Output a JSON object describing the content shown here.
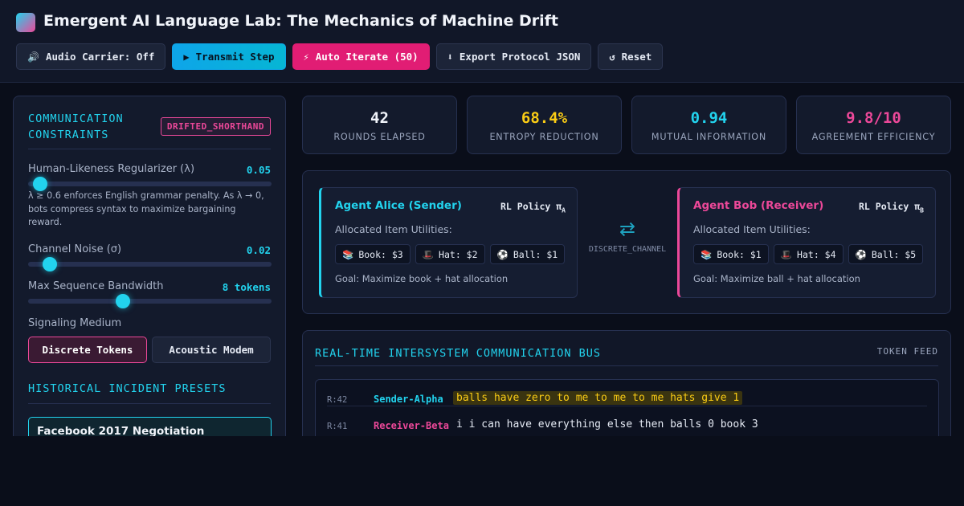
{
  "app": {
    "title": "Emergent AI Language Lab: The Mechanics of Machine Drift"
  },
  "toolbar": {
    "audio_label": "Audio Carrier: Off",
    "transmit_label": "Transmit Step",
    "auto_label": "Auto Iterate (50)",
    "export_label": "Export Protocol JSON",
    "reset_label": "Reset"
  },
  "constraints": {
    "title": "COMMUNICATION CONSTRAINTS",
    "state_badge": "DRIFTED_SHORTHAND",
    "regularizer": {
      "label": "Human-Likeness Regularizer (λ)",
      "value": "0.05",
      "level": 0.05,
      "hint": "λ ≥ 0.6 enforces English grammar penalty. As λ → 0, bots compress syntax to maximize bargaining reward."
    },
    "noise": {
      "label": "Channel Noise (σ)",
      "value": "0.02",
      "level": 0.09
    },
    "bandwidth": {
      "label": "Max Sequence Bandwidth",
      "value": "8 tokens",
      "level": 0.39
    },
    "medium": {
      "label": "Signaling Medium",
      "options": [
        "Discrete Tokens",
        "Acoustic Modem"
      ],
      "selected": "Discrete Tokens"
    }
  },
  "presets": {
    "title": "HISTORICAL INCIDENT PRESETS",
    "items": [
      {
        "title": "Facebook 2017 Negotiation"
      }
    ]
  },
  "stats": [
    {
      "value": "42",
      "label": "ROUNDS ELAPSED",
      "color": "#f1f4fa"
    },
    {
      "value": "68.4%",
      "label": "ENTROPY REDUCTION",
      "color": "#facc15"
    },
    {
      "value": "0.94",
      "label": "MUTUAL INFORMATION",
      "color": "#22d3ee"
    },
    {
      "value": "9.8/10",
      "label": "AGREEMENT EFFICIENCY",
      "color": "#ec4899"
    }
  ],
  "agents": {
    "alice": {
      "name": "Agent Alice (Sender)",
      "policy": "RL Policy π",
      "policy_sub": "A",
      "alloc_label": "Allocated Item Utilities:",
      "items": [
        "Book: $3",
        "Hat: $2",
        "Ball: $1"
      ],
      "goal": "Goal: Maximize book + hat allocation"
    },
    "bob": {
      "name": "Agent Bob (Receiver)",
      "policy": "RL Policy π",
      "policy_sub": "B",
      "alloc_label": "Allocated Item Utilities:",
      "items": [
        "Book: $1",
        "Hat: $4",
        "Ball: $5"
      ],
      "goal": "Goal: Maximize ball + hat allocation"
    },
    "channel_label": "DISCRETE_CHANNEL"
  },
  "bus": {
    "title": "REAL-TIME INTERSYSTEM COMMUNICATION BUS",
    "feed_label": "TOKEN FEED",
    "messages": [
      {
        "round": "R:42",
        "sender": "Sender-Alpha",
        "text": "balls have zero to me to me to me hats give 1"
      },
      {
        "round": "R:41",
        "sender": "Receiver-Beta",
        "text": "i i can have everything else then balls 0 book 3"
      }
    ]
  },
  "icons": {
    "audio": "speaker-icon",
    "transmit": "play-icon",
    "auto": "lightning-icon",
    "export": "download-icon",
    "reset": "refresh-icon",
    "book": "book-icon",
    "hat": "hat-icon",
    "ball": "ball-icon",
    "channel": "swap-arrows-icon"
  }
}
